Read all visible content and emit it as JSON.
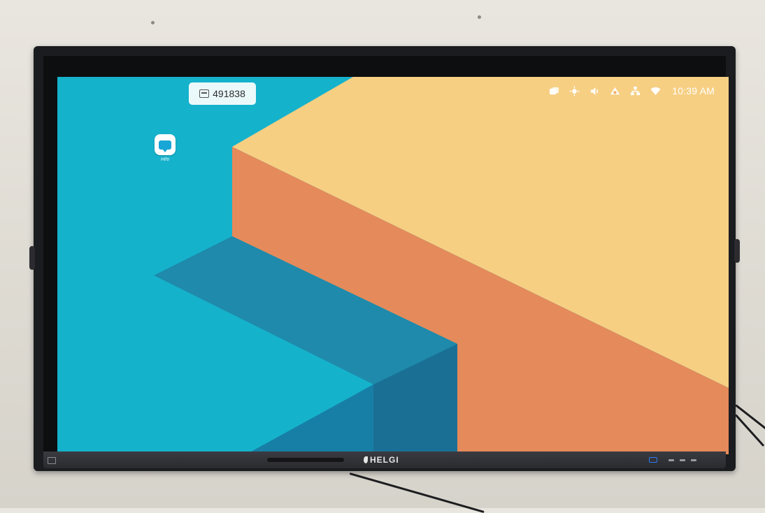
{
  "screen": {
    "code_badge": {
      "icon": "screen-share-code-icon",
      "text": "491838"
    },
    "app": {
      "icon": "chat-bubble-app-icon",
      "label": "Hihi"
    },
    "status_bar": {
      "icons": [
        "screen-switch-icon",
        "brightness-icon",
        "volume-icon",
        "cloud-icon",
        "ethernet-icon",
        "wifi-icon"
      ],
      "time": "10:39 AM"
    },
    "wallpaper_colors": {
      "teal": "#15b2cc",
      "teal_dark": "#1f7ea3",
      "sand": "#f6cf83",
      "orange": "#e58a5a"
    }
  },
  "monitor": {
    "brand": "HELGI",
    "led_color": "#2d7bf2"
  }
}
